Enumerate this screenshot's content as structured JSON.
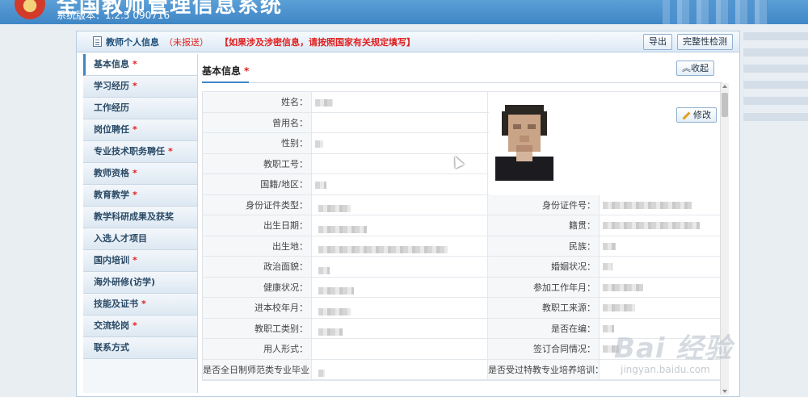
{
  "app": {
    "title": "全国教师管理信息系统",
    "version": "系统版本：1.2.5   090716"
  },
  "panel": {
    "title": "教师个人信息",
    "status": "（未报送）",
    "warning": "【如果涉及涉密信息，请按照国家有关规定填写】",
    "export_label": "导出",
    "check_label": "完整性检测"
  },
  "sidebar": {
    "items": [
      {
        "label": "基本信息",
        "required": true
      },
      {
        "label": "学习经历",
        "required": true
      },
      {
        "label": "工作经历",
        "required": false
      },
      {
        "label": "岗位聘任",
        "required": true
      },
      {
        "label": "专业技术职务聘任",
        "required": true
      },
      {
        "label": "教师资格",
        "required": true
      },
      {
        "label": "教育教学",
        "required": true
      },
      {
        "label": "教学科研成果及获奖",
        "required": false
      },
      {
        "label": "入选人才项目",
        "required": false
      },
      {
        "label": "国内培训",
        "required": true
      },
      {
        "label": "海外研修(访学)",
        "required": false
      },
      {
        "label": "技能及证书",
        "required": true
      },
      {
        "label": "交流轮岗",
        "required": true
      },
      {
        "label": "联系方式",
        "required": false
      }
    ],
    "required_mark": "*"
  },
  "section": {
    "title": "基本信息",
    "required_mark": "*",
    "collapse_label": "收起",
    "edit_label": "修改"
  },
  "form": {
    "top_rows": [
      {
        "label": "姓名："
      },
      {
        "label": "曾用名："
      },
      {
        "label": "性别："
      },
      {
        "label": "教职工号："
      },
      {
        "label": "国籍/地区："
      }
    ],
    "pair_rows": [
      {
        "left": "身份证件类型：",
        "right": "身份证件号："
      },
      {
        "left": "出生日期：",
        "right": "籍贯："
      },
      {
        "left": "出生地：",
        "right": "民族："
      },
      {
        "left": "政治面貌：",
        "right": "婚姻状况："
      },
      {
        "left": "健康状况：",
        "right": "参加工作年月："
      },
      {
        "left": "进本校年月：",
        "right": "教职工来源："
      },
      {
        "left": "教职工类别：",
        "right": "是否在编："
      },
      {
        "left": "用人形式：",
        "right": "签订合同情况："
      },
      {
        "left": "是否全日制师范类专业毕业：",
        "right": "是否受过特教专业培养培训："
      }
    ]
  },
  "watermark": {
    "logo": "Bai 经验",
    "url": "jingyan.baidu.com"
  }
}
